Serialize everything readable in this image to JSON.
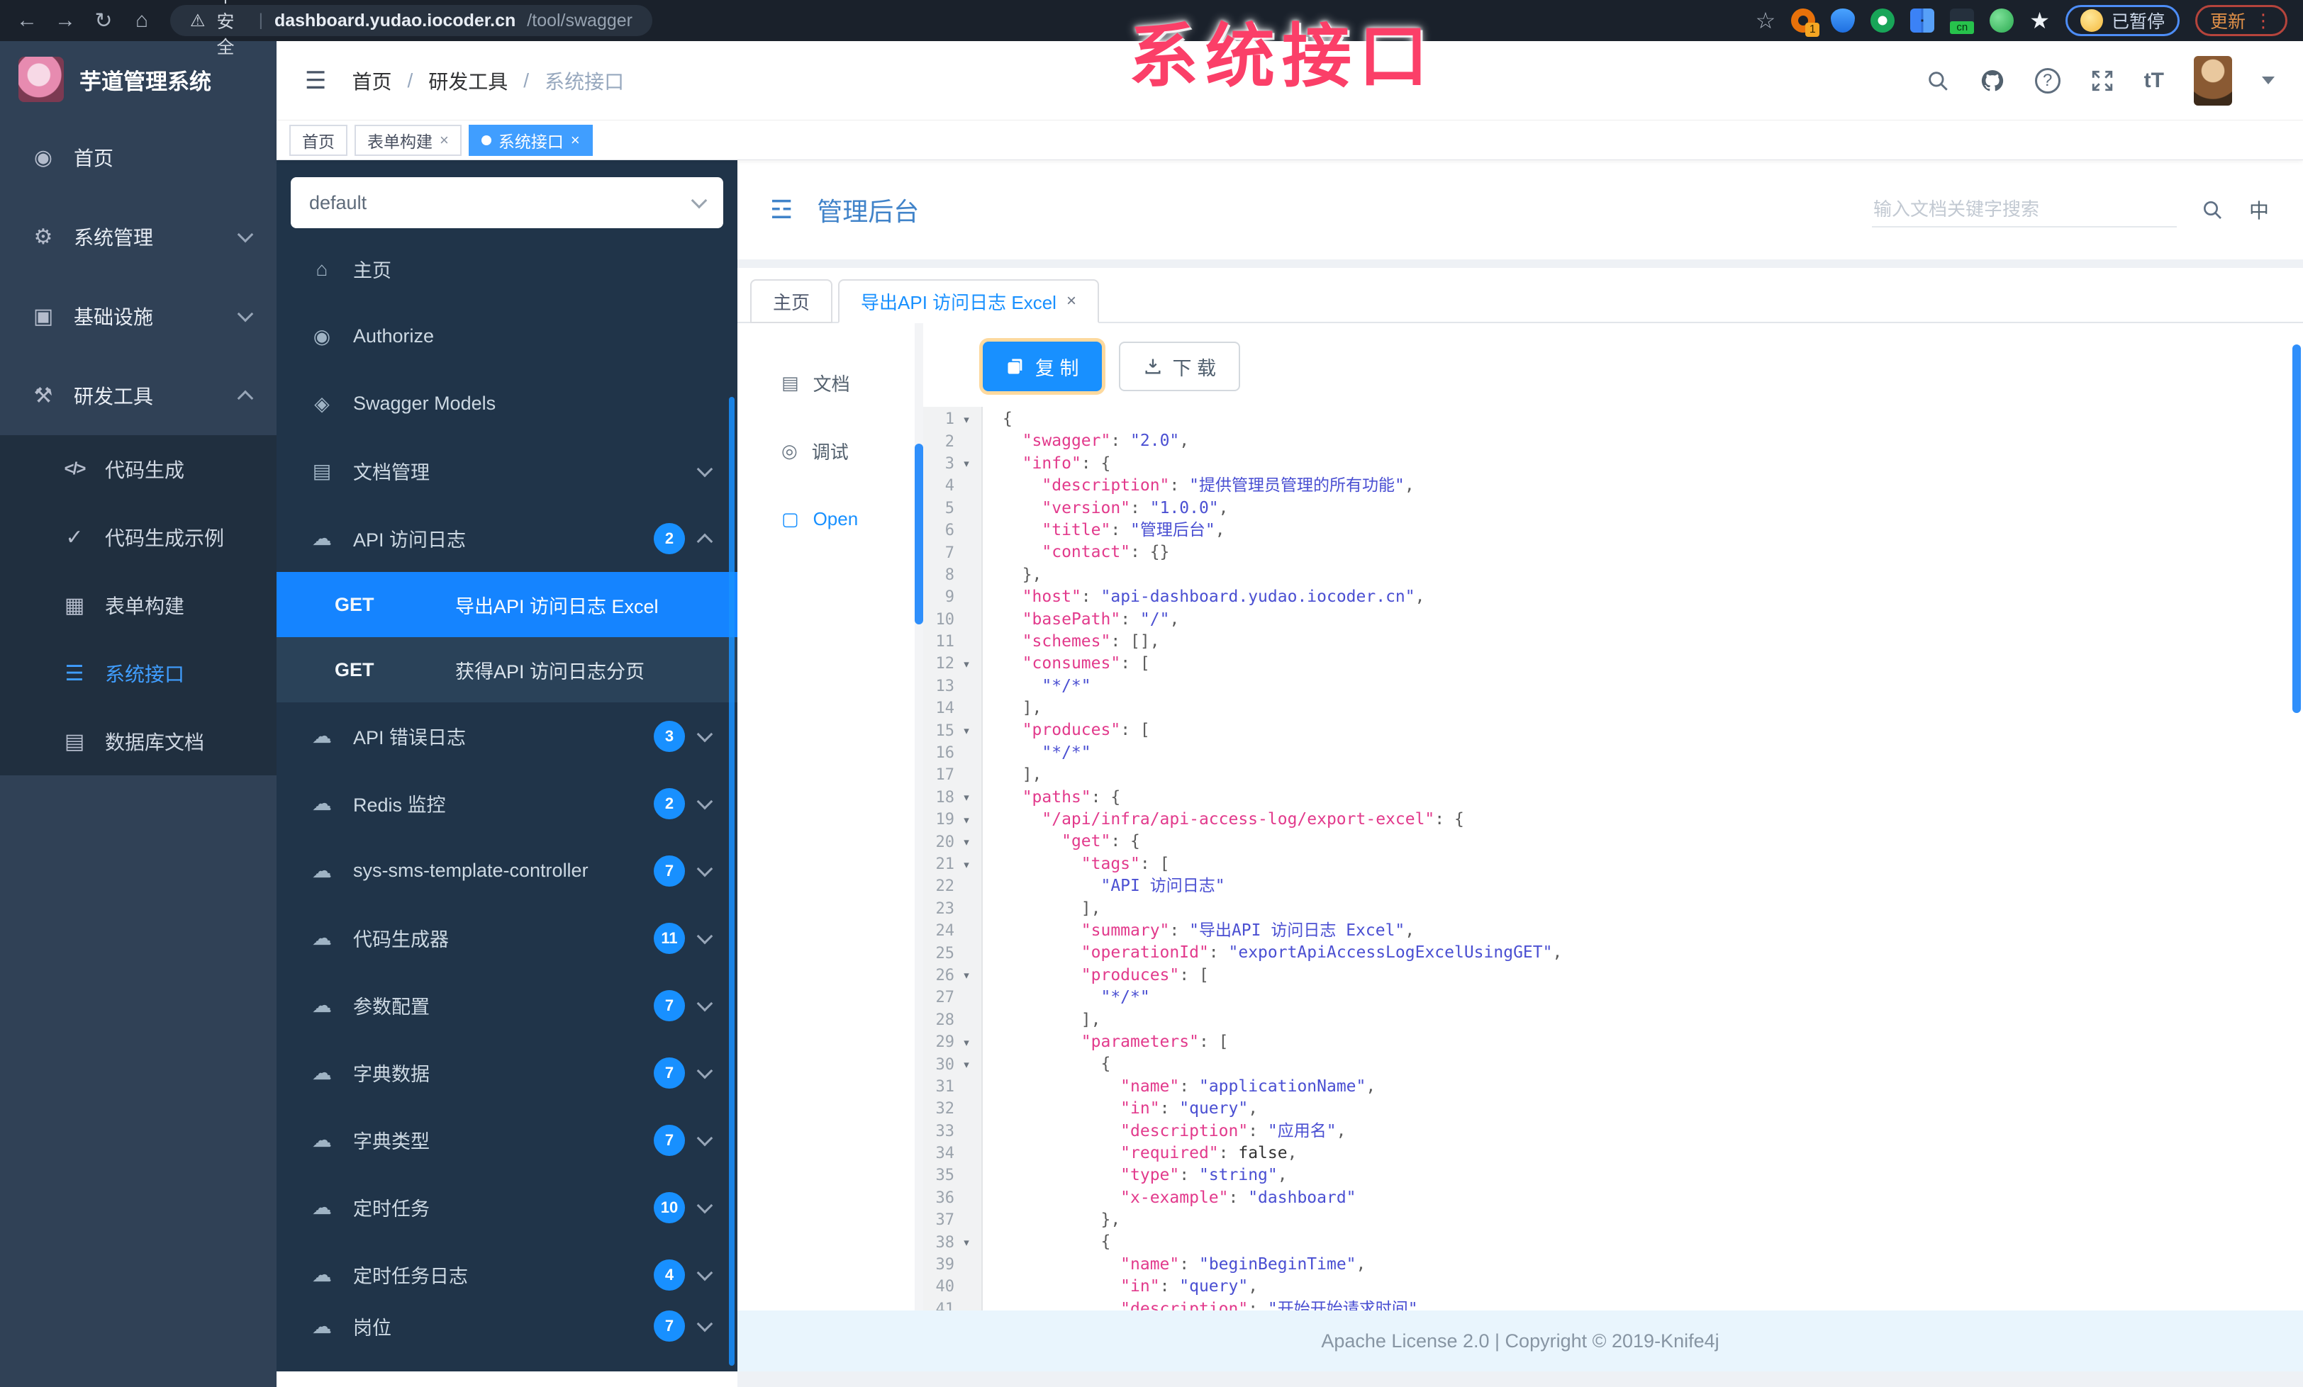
{
  "browser": {
    "security_label": "不安全",
    "url_host": "dashboard.yudao.iocoder.cn",
    "url_path": "/tool/swagger",
    "extension_badge": "1",
    "extension_cn_label": "cn",
    "paused_label": "已暂停",
    "update_label": "更新"
  },
  "overlay": {
    "text": "系统接口",
    "color": "#fb3f68"
  },
  "sidebar": {
    "title": "芋道管理系统",
    "items": [
      {
        "key": "home",
        "icon": "dashboard",
        "glyph": "◉",
        "label": "首页"
      },
      {
        "key": "system-management",
        "icon": "gear",
        "glyph": "⚙",
        "label": "系统管理",
        "chevron": "down"
      },
      {
        "key": "infrastructure",
        "icon": "monitor",
        "glyph": "▣",
        "label": "基础设施",
        "chevron": "down"
      },
      {
        "key": "dev-tools",
        "icon": "toolbox",
        "glyph": "⚒",
        "label": "研发工具",
        "chevron": "up"
      }
    ],
    "submenu": [
      {
        "key": "code-generation",
        "icon": "code",
        "glyph": "</>",
        "label": "代码生成"
      },
      {
        "key": "code-generation-example",
        "icon": "shield-check",
        "glyph": "✓",
        "label": "代码生成示例"
      },
      {
        "key": "form-builder",
        "icon": "table",
        "glyph": "▦",
        "label": "表单构建"
      },
      {
        "key": "system-api",
        "icon": "list",
        "glyph": "☰",
        "label": "系统接口",
        "active": true
      },
      {
        "key": "database-doc",
        "icon": "grid",
        "glyph": "▤",
        "label": "数据库文档"
      }
    ]
  },
  "breadcrumb": [
    "首页",
    "研发工具",
    "系统接口"
  ],
  "tags": [
    {
      "label": "首页"
    },
    {
      "label": "表单构建",
      "closable": true
    },
    {
      "label": "系统接口",
      "closable": true,
      "active": true
    }
  ],
  "doc_sidebar": {
    "select_value": "default",
    "items": [
      {
        "icon": "home",
        "glyph": "⌂",
        "label": "主页"
      },
      {
        "icon": "lock",
        "glyph": "◉",
        "label": "Authorize"
      },
      {
        "icon": "cube",
        "glyph": "◈",
        "label": "Swagger Models"
      },
      {
        "icon": "doc",
        "glyph": "▤",
        "label": "文档管理",
        "chevron": "down"
      },
      {
        "icon": "cloud",
        "glyph": "☁",
        "label": "API 访问日志",
        "badge": "2",
        "chevron": "up"
      },
      {
        "method": "GET",
        "label": "导出API 访问日志 Excel",
        "active": true
      },
      {
        "method": "GET",
        "label": "获得API 访问日志分页"
      },
      {
        "icon": "cloud",
        "glyph": "☁",
        "label": "API 错误日志",
        "badge": "3",
        "chevron": "down"
      },
      {
        "icon": "cloud",
        "glyph": "☁",
        "label": "Redis 监控",
        "badge": "2",
        "chevron": "down"
      },
      {
        "icon": "cloud",
        "glyph": "☁",
        "label": "sys-sms-template-controller",
        "badge": "7",
        "chevron": "down"
      },
      {
        "icon": "cloud",
        "glyph": "☁",
        "label": "代码生成器",
        "badge": "11",
        "chevron": "down"
      },
      {
        "icon": "cloud",
        "glyph": "☁",
        "label": "参数配置",
        "badge": "7",
        "chevron": "down"
      },
      {
        "icon": "cloud",
        "glyph": "☁",
        "label": "字典数据",
        "badge": "7",
        "chevron": "down"
      },
      {
        "icon": "cloud",
        "glyph": "☁",
        "label": "字典类型",
        "badge": "7",
        "chevron": "down"
      },
      {
        "icon": "cloud",
        "glyph": "☁",
        "label": "定时任务",
        "badge": "10",
        "chevron": "down"
      },
      {
        "icon": "cloud",
        "glyph": "☁",
        "label": "定时任务日志",
        "badge": "4",
        "chevron": "down"
      },
      {
        "icon": "cloud",
        "glyph": "☁",
        "label": "岗位",
        "badge": "7",
        "chevron": "down",
        "cut": true
      }
    ]
  },
  "doc_header": {
    "title": "管理后台",
    "search_placeholder": "输入文档关键字搜索",
    "lang_label": "中"
  },
  "doc_tabs": [
    {
      "label": "主页"
    },
    {
      "label": "导出API 访问日志 Excel",
      "closable": true,
      "active": true
    }
  ],
  "mini_sidebar": [
    {
      "icon": "document",
      "glyph": "▤",
      "label": "文档"
    },
    {
      "icon": "debug",
      "glyph": "◎",
      "label": "调试"
    },
    {
      "icon": "file",
      "glyph": "▢",
      "label": "Open",
      "active": true
    }
  ],
  "toolbar": {
    "copy_label": "复 制",
    "download_label": "下 载"
  },
  "code": {
    "fold_lines": [
      1,
      3,
      12,
      15,
      18,
      19,
      20,
      21,
      26,
      29,
      30,
      38
    ],
    "lines": [
      "{",
      "  \"swagger\": \"2.0\",",
      "  \"info\": {",
      "    \"description\": \"提供管理员管理的所有功能\",",
      "    \"version\": \"1.0.0\",",
      "    \"title\": \"管理后台\",",
      "    \"contact\": {}",
      "  },",
      "  \"host\": \"api-dashboard.yudao.iocoder.cn\",",
      "  \"basePath\": \"/\",",
      "  \"schemes\": [],",
      "  \"consumes\": [",
      "    \"*/*\"",
      "  ],",
      "  \"produces\": [",
      "    \"*/*\"",
      "  ],",
      "  \"paths\": {",
      "    \"/api/infra/api-access-log/export-excel\": {",
      "      \"get\": {",
      "        \"tags\": [",
      "          \"API 访问日志\"",
      "        ],",
      "        \"summary\": \"导出API 访问日志 Excel\",",
      "        \"operationId\": \"exportApiAccessLogExcelUsingGET\",",
      "        \"produces\": [",
      "          \"*/*\"",
      "        ],",
      "        \"parameters\": [",
      "          {",
      "            \"name\": \"applicationName\",",
      "            \"in\": \"query\",",
      "            \"description\": \"应用名\",",
      "            \"required\": false,",
      "            \"type\": \"string\",",
      "            \"x-example\": \"dashboard\"",
      "          },",
      "          {",
      "            \"name\": \"beginBeginTime\",",
      "            \"in\": \"query\",",
      "            \"description\": \"开始开始请求时间\""
    ]
  },
  "footer": {
    "text": "Apache License 2.0 | Copyright © 2019-Knife4j"
  }
}
